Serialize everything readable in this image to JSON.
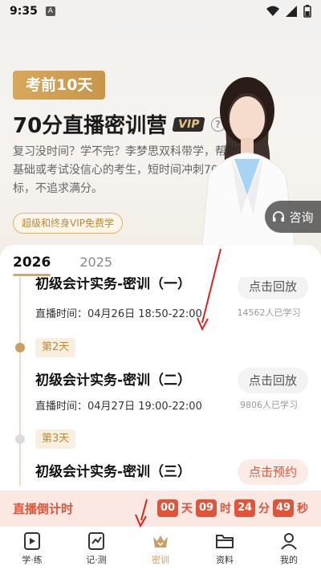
{
  "status": {
    "time": "9:35",
    "a_badge": "A"
  },
  "hero": {
    "badge": "考前10天",
    "title": "70分直播密训营",
    "vip": "VIP",
    "help": "?",
    "desc": "复习没时间？学不完？李梦思双科带学，帮助零基础或考试没信心的考生，短时间冲刺70分目标，不追求满分。",
    "pill": "超级和终身VIP免费学",
    "consult": "咨询"
  },
  "years": {
    "active": "2026",
    "other": "2025"
  },
  "courses": [
    {
      "title": "初级会计实务-密训（一）",
      "time": "直播时间：04月26日 18:50-22:00",
      "action": "点击回放",
      "learners": "14562人已学习"
    },
    {
      "day": "第2天",
      "title": "初级会计实务-密训（二）",
      "time": "直播时间：04月27日 19:00-22:00",
      "action": "点击回放",
      "learners": "9806人已学习"
    },
    {
      "day": "第3天",
      "title": "初级会计实务-密训（三）",
      "action": "点击预约"
    }
  ],
  "countdown": {
    "label": "直播倒计时",
    "days": "00",
    "days_unit": "天",
    "hours": "09",
    "hours_unit": "时",
    "minutes": "24",
    "minutes_unit": "分",
    "seconds": "49",
    "seconds_unit": "秒"
  },
  "nav": [
    {
      "label": "学·练",
      "icon": "play-icon"
    },
    {
      "label": "记·测",
      "icon": "chart-icon"
    },
    {
      "label": "密训",
      "icon": "crown-icon"
    },
    {
      "label": "资料",
      "icon": "folder-icon"
    },
    {
      "label": "我的",
      "icon": "user-icon"
    }
  ],
  "colors": {
    "accent": "#c9a061",
    "countdown": "#e0543a"
  }
}
